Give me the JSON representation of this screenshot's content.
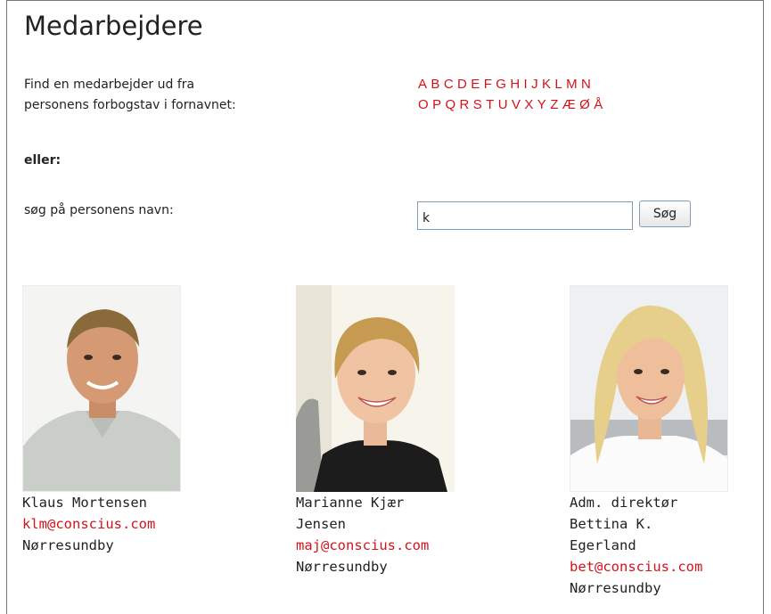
{
  "page": {
    "title": "Medarbejdere",
    "intro_line1": "Find en medarbejder ud fra",
    "intro_line2": "personens forbogstav i fornavnet:",
    "or_label": "eller:",
    "search_label": "søg på personens navn:"
  },
  "alphabet": {
    "row1": [
      "A",
      "B",
      "C",
      "D",
      "E",
      "F",
      "G",
      "H",
      "I",
      "J",
      "K",
      "L",
      "M",
      "N"
    ],
    "row2": [
      "O",
      "P",
      "Q",
      "R",
      "S",
      "T",
      "U",
      "V",
      "X",
      "Y",
      "Z",
      "Æ",
      "Ø",
      "Å"
    ]
  },
  "search": {
    "value": "k",
    "button_label": "Søg"
  },
  "employees": [
    {
      "title_line": "",
      "name_line1": "Klaus Mortensen",
      "name_line2": "",
      "email": "klm@conscius.com",
      "city": "Nørresundby"
    },
    {
      "title_line": "",
      "name_line1": "Marianne Kjær",
      "name_line2": "Jensen",
      "email": "maj@conscius.com",
      "city": "Nørresundby"
    },
    {
      "title_line": "Adm. direktør",
      "name_line1": "Bettina K.",
      "name_line2": "Egerland",
      "email": "bet@conscius.com",
      "city": "Nørresundby"
    }
  ],
  "colors": {
    "link": "#d4121b",
    "text": "#222222",
    "input_border": "#7f9db9"
  }
}
